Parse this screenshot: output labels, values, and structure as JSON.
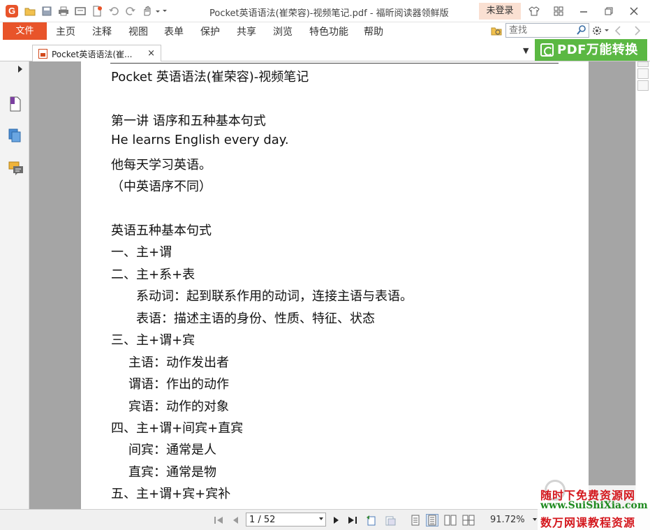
{
  "titlebar": {
    "app_logo": "G",
    "window_title": "Pocket英语语法(崔荣容)-视频笔记.pdf - 福昕阅读器领鲜版",
    "login_label": "未登录"
  },
  "menubar": {
    "file_label": "文件",
    "items": [
      "主页",
      "注释",
      "视图",
      "表单",
      "保护",
      "共享",
      "浏览",
      "特色功能",
      "帮助"
    ],
    "search_placeholder": "查找"
  },
  "tabbar": {
    "tab_label": "Pocket英语语法(崔...",
    "close_glyph": "×",
    "dropdown_glyph": "▼",
    "pdf_convert_label": "PDF万能转换"
  },
  "document": {
    "lines": [
      "Pocket 英语语法(崔荣容)-视频笔记",
      "第一讲  语序和五种基本句式",
      "He learns English every day.",
      "他每天学习英语。",
      "（中英语序不同）",
      "英语五种基本句式",
      "一、主+谓",
      "二、主+系+表",
      "系动词：起到联系作用的动词，连接主语与表语。",
      "表语：描述主语的身份、性质、特征、状态",
      "三、主+谓+宾",
      "主语：动作发出者",
      "谓语：作出的动作",
      "宾语：动作的对象",
      "四、主+谓+间宾+直宾",
      "间宾：通常是人",
      "直宾：通常是物",
      "五、主+谓+宾+宾补"
    ]
  },
  "statusbar": {
    "page_value": "1 / 52",
    "zoom_value": "91.72%"
  },
  "watermark": {
    "line1": "随时下免费资源网",
    "line2": "www.SuiShiXia.com",
    "line3": "数万网课教程资源"
  },
  "icons": {
    "sidebar": [
      "page-thumbnail-icon",
      "layers-icon",
      "comments-icon"
    ],
    "accent": "#e8542a",
    "convert_green": "#5bb843"
  }
}
